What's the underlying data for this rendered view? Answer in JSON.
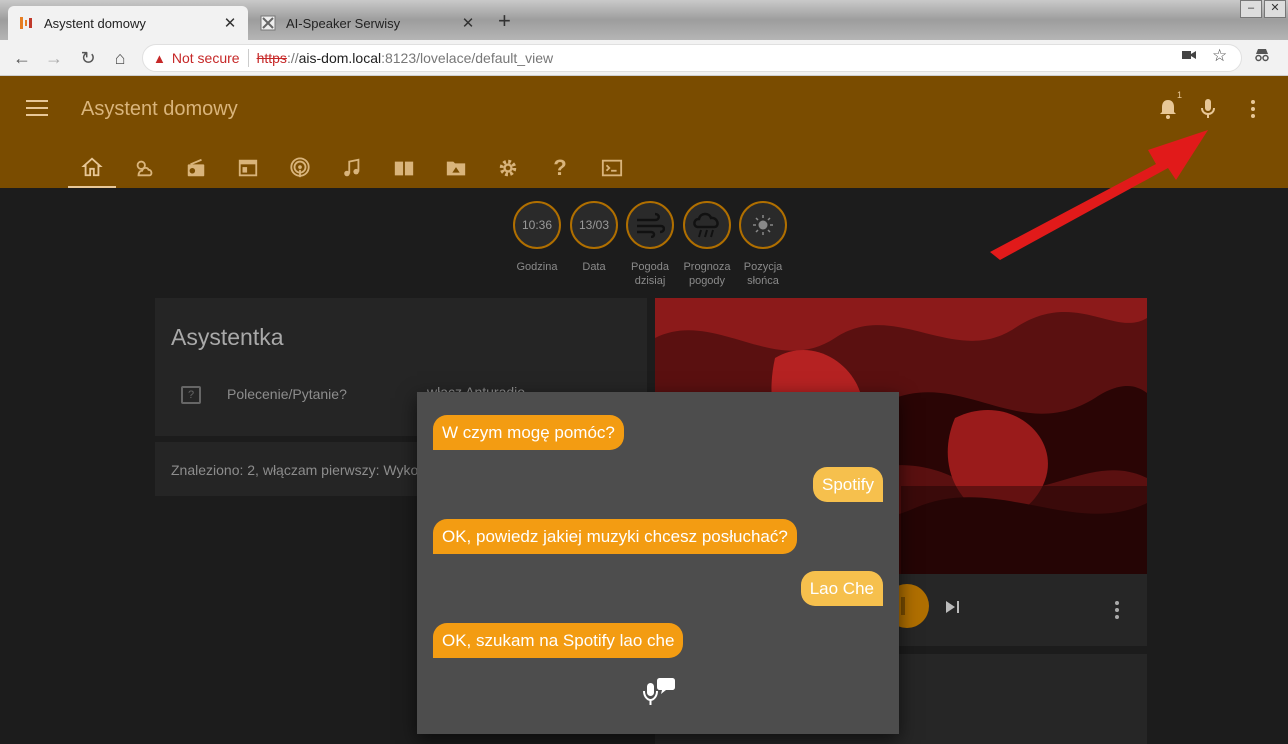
{
  "browser": {
    "tabs": [
      {
        "title": "Asystent domowy",
        "active": true
      },
      {
        "title": "AI-Speaker Serwisy",
        "active": false
      }
    ],
    "close_glyph": "✕",
    "new_tab_glyph": "+",
    "url": {
      "security_label": "Not secure",
      "scheme": "https",
      "host_sep": "://",
      "host": "ais-dom.local",
      "path": ":8123/lovelace/default_view"
    }
  },
  "app": {
    "title": "Asystent domowy",
    "notification_count": "1",
    "accent_color": "#7a4c00",
    "nav_tabs": [
      "home-icon",
      "weather-icon",
      "radio-icon",
      "media-panel-icon",
      "podcast-icon",
      "music-icon",
      "book-icon",
      "folder-icon",
      "gear-icon",
      "help-icon",
      "console-icon"
    ]
  },
  "badges": [
    {
      "value": "10:36",
      "label": "Godzina"
    },
    {
      "value": "13/03",
      "label": "Data"
    },
    {
      "value": "",
      "icon": "wind-icon",
      "label": "Pogoda dzisiaj"
    },
    {
      "value": "",
      "icon": "rain-cloud-icon",
      "label": "Prognoza pogody"
    },
    {
      "value": "",
      "icon": "sun-icon",
      "label": "Pozycja słońca"
    }
  ],
  "assistant_card": {
    "title": "Asystentka",
    "field_label": "Polecenie/Pytanie?",
    "field_value": "włącz Anturadio",
    "result": "Znaleziono: 2, włączam pierwszy: Wykonawca Lao Che"
  },
  "dialog": {
    "messages": [
      {
        "from": "ai",
        "text": "W czym mogę pomóc?"
      },
      {
        "from": "user",
        "text": "Spotify"
      },
      {
        "from": "ai",
        "text": "OK, powiedz jakiej muzyki chcesz posłuchać?"
      },
      {
        "from": "user",
        "text": "Lao Che"
      },
      {
        "from": "ai",
        "text": "OK, szukam na Spotify lao che"
      }
    ],
    "ai_color": "#f39c12",
    "user_color": "#f6c04d"
  }
}
